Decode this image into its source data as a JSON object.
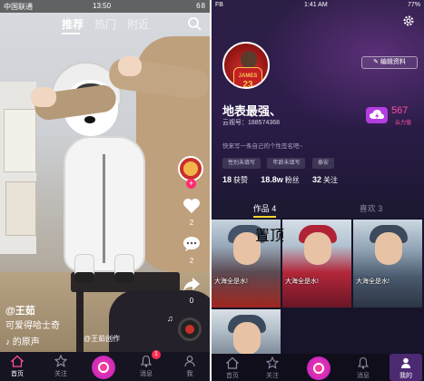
{
  "left": {
    "status": {
      "carrier": "中国联通",
      "time": "13:50",
      "battery": "68"
    },
    "topnav": {
      "tab_recommend": "推荐",
      "tab_hot": "热门",
      "tab_nearby": "附近"
    },
    "side": {
      "likes": "2",
      "comments": "2",
      "shares": "0"
    },
    "caption": {
      "user": "@王茹",
      "text": "可爱得哈士奇",
      "music": "的原声",
      "music_credit": "@王茹创作"
    },
    "bottom_nav": {
      "home": "首页",
      "follow": "关注",
      "message": "消息",
      "me": "我",
      "message_badge": "1"
    }
  },
  "right": {
    "status": {
      "carrier": "FB",
      "time": "1:41 AM",
      "battery": "77%"
    },
    "profile": {
      "edit_label": "编辑资料",
      "jersey_text": "JAMES",
      "jersey_number": "23",
      "name": "地表最强、",
      "huoshan_id": "云视号：188574368",
      "power_value": "567",
      "power_label": "云力值",
      "signature": "快来写一条自己的个性签名吧~",
      "tags": [
        "性别未填写",
        "年龄未填写",
        "泰安"
      ],
      "stats": [
        {
          "num": "18",
          "label": "获赞"
        },
        {
          "num": "18.8w",
          "label": "粉丝"
        },
        {
          "num": "32",
          "label": "关注"
        }
      ]
    },
    "tabs": {
      "works": "作品 4",
      "likes": "喜欢 3"
    },
    "grid": [
      {
        "title": "大海全是水!",
        "badge": ""
      },
      {
        "title": "大海全是水!",
        "badge": ""
      },
      {
        "title": "大海全是水!",
        "badge": ""
      },
      {
        "title": "",
        "badge": ""
      }
    ],
    "grid_badge": "置顶",
    "bottom_nav": {
      "home": "首页",
      "follow": "关注",
      "message": "消息",
      "me": "我的"
    }
  }
}
